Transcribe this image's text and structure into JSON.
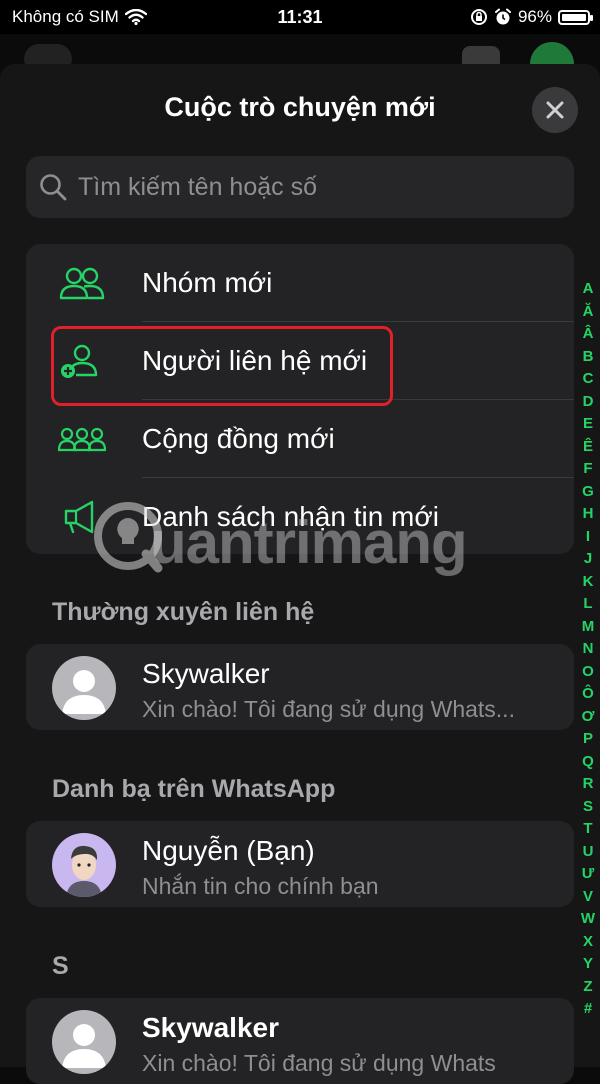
{
  "status_bar": {
    "carrier": "Không có SIM",
    "time": "11:31",
    "battery": "96%",
    "battery_level": 0.96
  },
  "header": {
    "title": "Cuộc trò chuyện mới",
    "close_icon": "close-icon"
  },
  "search": {
    "placeholder": "Tìm kiếm tên hoặc số",
    "value": ""
  },
  "menu": {
    "items": [
      {
        "label": "Nhóm mới",
        "icon": "group-icon"
      },
      {
        "label": "Người liên hệ mới",
        "icon": "add-contact-icon"
      },
      {
        "label": "Cộng đồng mới",
        "icon": "community-icon"
      },
      {
        "label": "Danh sách nhận tin mới",
        "icon": "megaphone-icon"
      }
    ]
  },
  "frequent": {
    "heading": "Thường xuyên liên hệ",
    "contacts": [
      {
        "name": "Skywalker",
        "status": "Xin chào! Tôi đang sử dụng Whats..."
      }
    ]
  },
  "whatsapp_contacts": {
    "heading": "Danh bạ trên WhatsApp",
    "contacts": [
      {
        "name": "Nguyễn (Bạn)",
        "status": "Nhắn tin cho chính bạn"
      }
    ]
  },
  "letter_section": {
    "heading": "S",
    "contacts": [
      {
        "name": "Skywalker",
        "status": "Xin chào! Tôi đang sử dụng Whats"
      }
    ]
  },
  "alphabet_index": [
    "A",
    "Ă",
    "Â",
    "B",
    "C",
    "D",
    "E",
    "Ê",
    "F",
    "G",
    "H",
    "I",
    "J",
    "K",
    "L",
    "M",
    "N",
    "O",
    "Ô",
    "Ơ",
    "P",
    "Q",
    "R",
    "S",
    "T",
    "U",
    "Ư",
    "V",
    "W",
    "X",
    "Y",
    "Z",
    "#"
  ],
  "watermark": "uantrimang",
  "colors": {
    "accent_green": "#25d366",
    "highlight_red": "#e0202a",
    "background": "#161616",
    "card": "#232325"
  }
}
